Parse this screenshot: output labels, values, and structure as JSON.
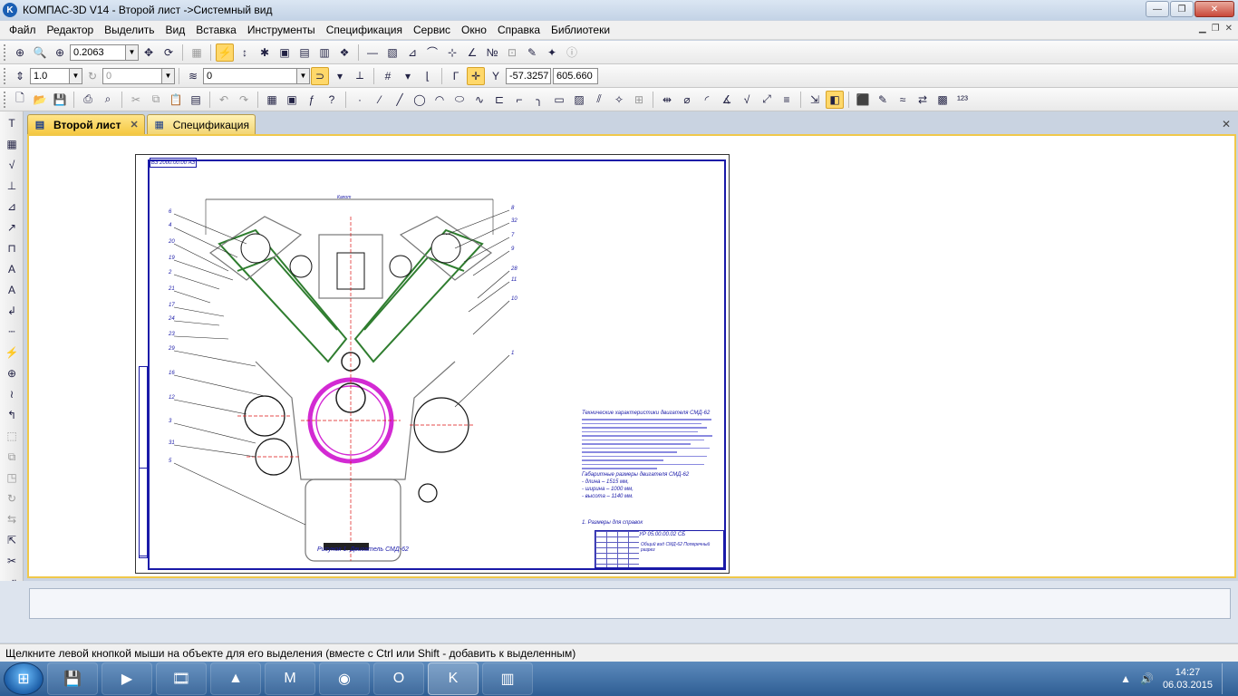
{
  "window": {
    "title": "КОМПАС-3D V14 - Второй лист ->Системный вид",
    "app_icon_letter": "K",
    "minimize": "—",
    "maximize": "❐",
    "close": "✕"
  },
  "menu": [
    "Файл",
    "Редактор",
    "Выделить",
    "Вид",
    "Вставка",
    "Инструменты",
    "Спецификация",
    "Сервис",
    "Окно",
    "Справка",
    "Библиотеки"
  ],
  "toolbar1": {
    "zoom_value": "0.2063"
  },
  "toolbar2": {
    "step_value": "1.0",
    "angle_value": "0",
    "layer_value": "0",
    "coord_x": "-57.3257",
    "coord_y": "605.660"
  },
  "tabs": [
    {
      "label": "Второй лист",
      "active": true,
      "icon": "sheet-icon"
    },
    {
      "label": "Спецификация",
      "active": false,
      "icon": "spec-icon"
    }
  ],
  "drawing": {
    "sheet_stamp": "ВЗ 2000.00.00 АЗ",
    "callouts_left": [
      "6",
      "4",
      "20",
      "19",
      "2",
      "21",
      "17",
      "24",
      "23",
      "29",
      "16",
      "12",
      "3",
      "31",
      "5"
    ],
    "callouts_right": [
      "8",
      "32",
      "7",
      "9",
      "28",
      "11",
      "10",
      "1"
    ],
    "top_label": "Капот",
    "tech_title": "Технические характеристики двигателя СМД-62",
    "dimensions_title": "Габаритные размеры двигателя СМД-62",
    "dimension_lines": [
      "- длина – 1515 мм,",
      "- ширина – 1000 мм,",
      "- высота – 1140 мм."
    ],
    "note": "1. Размеры для справок",
    "caption": "Рисунок 1. Двигатель СМД-62",
    "title_block_code": "УР 05.00.00.02 СБ",
    "title_block_name": "Общий вид СМД-62 Поперечный разрез"
  },
  "status_text": "Щелкните левой кнопкой мыши на объекте для его выделения (вместе с Ctrl или Shift - добавить к выделенным)",
  "taskbar": {
    "apps": [
      "floppy-icon",
      "media-player-icon",
      "video-icon",
      "archicad-icon",
      "mathcad-icon",
      "chrome-icon",
      "opera-icon",
      "kompas-icon",
      "winrar-icon"
    ],
    "open_app": "kompas-icon",
    "time": "14:27",
    "date": "06.03.2015"
  },
  "colors": {
    "tab_active": "#f5c842",
    "frame": "#1a1aa8",
    "work_border": "#f0c84a",
    "taskbar": "#2e5d93"
  }
}
